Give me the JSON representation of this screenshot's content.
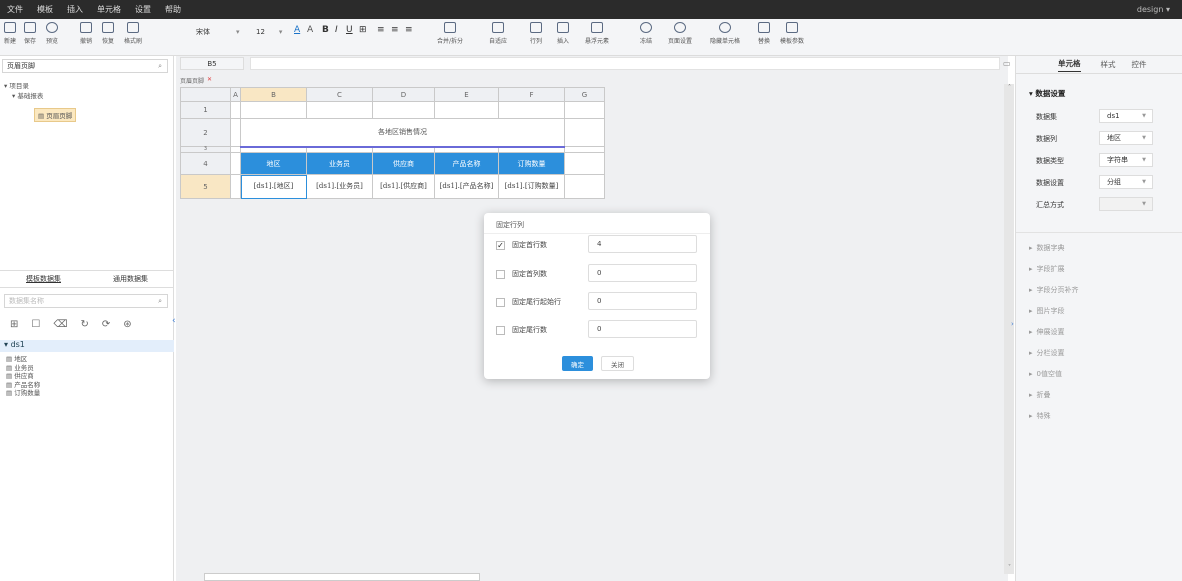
{
  "menu": [
    "文件",
    "模板",
    "插入",
    "单元格",
    "设置",
    "帮助"
  ],
  "user": "design",
  "toolbar": {
    "buttons": [
      "新建",
      "保存",
      "预览",
      "撤销",
      "恢复",
      "格式刷",
      "合并/拆分",
      "自适应",
      "行列",
      "插入",
      "悬浮元素",
      "冻结",
      "页面设置",
      "隐藏单元格",
      "替换",
      "模板参数"
    ],
    "font_name": "宋体",
    "font_size": "12",
    "format_glyphs": [
      "A",
      "A",
      "B",
      "I",
      "U",
      "⊞",
      "≡",
      "≡",
      "≡"
    ]
  },
  "left": {
    "search_value": "页眉页脚",
    "tree": [
      "项目录",
      "基础报表",
      "页眉页脚"
    ],
    "tabs": [
      "模板数据集",
      "通用数据集"
    ],
    "ds_search_placeholder": "数据集名称",
    "dataset": "ds1",
    "fields": [
      "地区",
      "业务员",
      "供应商",
      "产品名称",
      "订购数量"
    ]
  },
  "sheet": {
    "cell_ref": "B5",
    "tab": "页眉页脚",
    "columns": [
      "A",
      "B",
      "C",
      "D",
      "E",
      "F",
      "G"
    ],
    "rows": [
      "1",
      "2",
      "3",
      "4",
      "5"
    ],
    "title": "各地区销售情况",
    "headers": [
      "地区",
      "业务员",
      "供应商",
      "产品名称",
      "订购数量"
    ],
    "data": [
      "[ds1].[地区]",
      "[ds1].[业务员]",
      "[ds1].[供应商]",
      "[ds1].[产品名称]",
      "[ds1].[订购数量]"
    ]
  },
  "dialog": {
    "title": "固定行列",
    "rows": [
      {
        "label": "固定首行数",
        "value": "4",
        "checked": true
      },
      {
        "label": "固定首列数",
        "value": "0",
        "checked": false
      },
      {
        "label": "固定尾行起始行",
        "value": "0",
        "checked": false
      },
      {
        "label": "固定尾行数",
        "value": "0",
        "checked": false
      }
    ],
    "ok": "确定",
    "close": "关闭"
  },
  "right": {
    "tabs": [
      "单元格",
      "样式",
      "控件"
    ],
    "section": "数据设置",
    "fields": [
      {
        "label": "数据集",
        "value": "ds1"
      },
      {
        "label": "数据列",
        "value": "地区"
      },
      {
        "label": "数据类型",
        "value": "字符串"
      },
      {
        "label": "数据设置",
        "value": "分组"
      },
      {
        "label": "汇总方式",
        "value": ""
      }
    ],
    "sections": [
      "数据字典",
      "字段扩展",
      "字段分页补齐",
      "图片字段",
      "伸展设置",
      "分栏设置",
      "0值空值",
      "折叠",
      "特殊"
    ]
  },
  "colors": {
    "accent": "#2c8fdc",
    "menubar": "#2b2b2b",
    "title_underline": "#6a6ad8",
    "selected_header": "#f9e7c4"
  }
}
